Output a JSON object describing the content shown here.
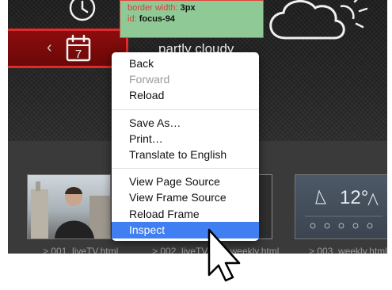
{
  "tooltip": {
    "line1_label": "border width: ",
    "line1_value": "3px",
    "line2_label": "id: ",
    "line2_value": "focus-94"
  },
  "weather": {
    "condition": "partly cloudy",
    "temperature": "12°"
  },
  "calendar_day": "7",
  "context_menu": {
    "group1": [
      {
        "label": "Back",
        "enabled": true
      },
      {
        "label": "Forward",
        "enabled": false
      },
      {
        "label": "Reload",
        "enabled": true
      }
    ],
    "group2": [
      {
        "label": "Save As…",
        "enabled": true
      },
      {
        "label": "Print…",
        "enabled": true
      },
      {
        "label": "Translate to English",
        "enabled": true
      }
    ],
    "group3": [
      {
        "label": "View Page Source",
        "enabled": true
      },
      {
        "label": "View Frame Source",
        "enabled": true
      },
      {
        "label": "Reload Frame",
        "enabled": true
      },
      {
        "label": "Inspect",
        "enabled": true,
        "highlighted": true
      }
    ]
  },
  "thumbnails": [
    {
      "label": "> 001_liveTV.html"
    },
    {
      "label": "> 002_liveTV.html weekly.html"
    },
    {
      "label": "> 003_weekly.html"
    }
  ],
  "colors": {
    "focus_border": "#e02b2b",
    "tooltip_bg": "#8fca96",
    "menu_highlight": "#3f7ff2"
  }
}
